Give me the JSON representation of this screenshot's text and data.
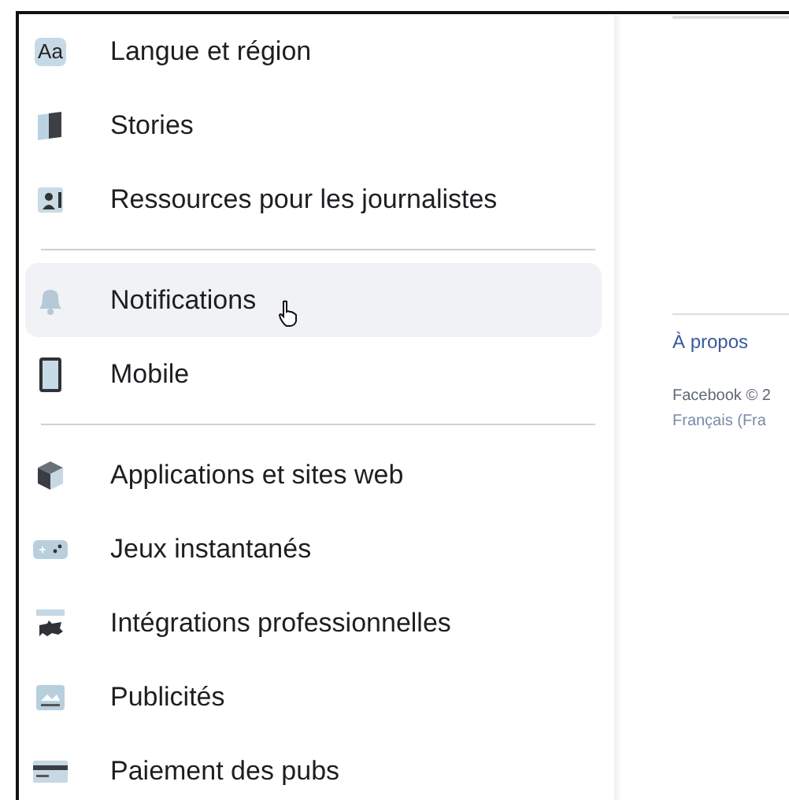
{
  "sidebar": {
    "sections": [
      {
        "items": [
          {
            "label": "Langue et région",
            "selected": false
          },
          {
            "label": "Stories",
            "selected": false
          },
          {
            "label": "Ressources pour les journalistes",
            "selected": false
          }
        ]
      },
      {
        "items": [
          {
            "label": "Notifications",
            "selected": true
          },
          {
            "label": "Mobile",
            "selected": false
          }
        ]
      },
      {
        "items": [
          {
            "label": "Applications et sites web",
            "selected": false
          },
          {
            "label": "Jeux instantanés",
            "selected": false
          },
          {
            "label": "Intégrations professionnelles",
            "selected": false
          },
          {
            "label": "Publicités",
            "selected": false
          },
          {
            "label": "Paiement des pubs",
            "selected": false
          }
        ]
      }
    ]
  },
  "icon_glyphs": {
    "language": "Aa"
  },
  "footer": {
    "links": [
      "À propos"
    ],
    "copyright": "Facebook © 2",
    "language": "Français (Fra"
  }
}
